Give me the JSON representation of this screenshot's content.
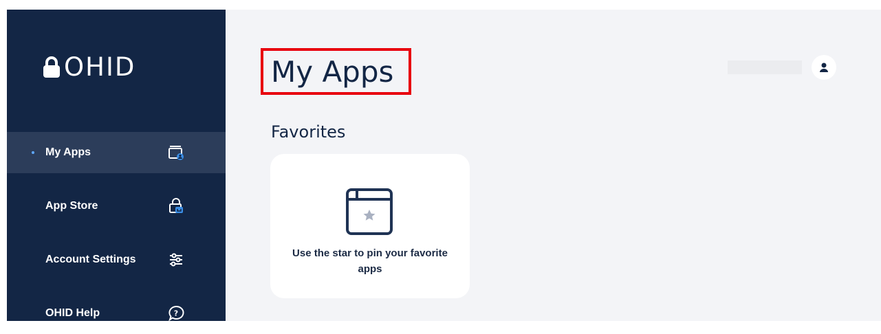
{
  "sidebar": {
    "logo_text": "OHID",
    "items": [
      {
        "label": "My Apps",
        "icon": "apps-icon",
        "active": true
      },
      {
        "label": "App Store",
        "icon": "app-store-icon",
        "active": false
      },
      {
        "label": "Account Settings",
        "icon": "sliders-icon",
        "active": false
      },
      {
        "label": "OHID Help",
        "icon": "help-chat-icon",
        "active": false
      }
    ]
  },
  "main": {
    "title": "My Apps",
    "favorites": {
      "heading": "Favorites",
      "empty_message": "Use the star to pin your favorite apps"
    }
  },
  "header": {
    "avatar_icon": "user-icon"
  },
  "colors": {
    "sidebar_bg": "#132645",
    "sidebar_active_bg": "#2c3d5a",
    "accent_blue": "#3b8ee6",
    "main_bg": "#f3f4f7",
    "highlight_red": "#e8000e",
    "text_dark": "#132645"
  }
}
